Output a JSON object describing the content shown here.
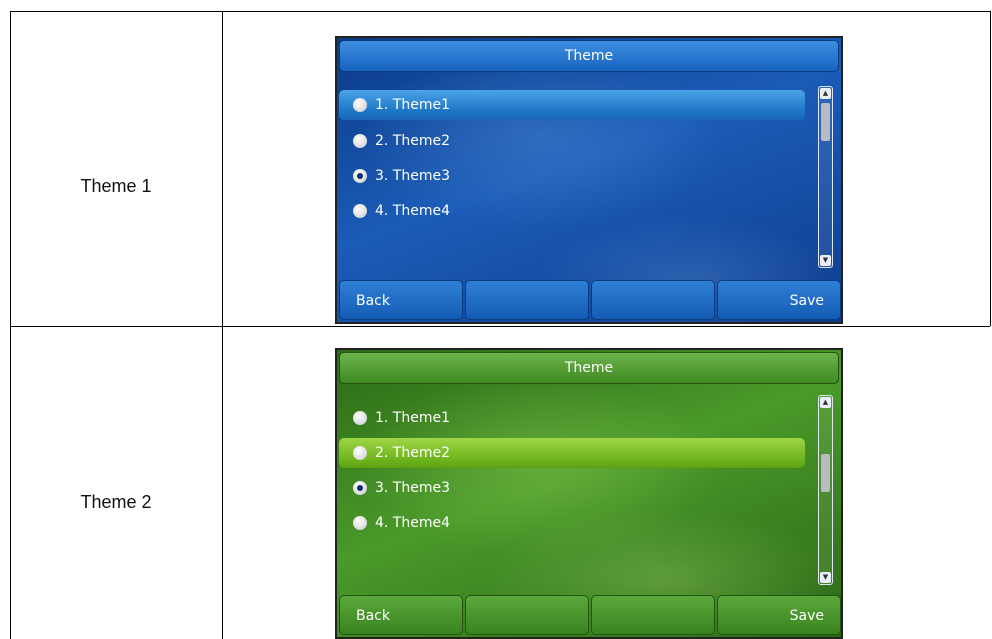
{
  "rows": [
    {
      "label": "Theme 1",
      "screen": {
        "title": "Theme",
        "items": [
          {
            "label": "1. Theme1",
            "checked": false,
            "selected": true
          },
          {
            "label": "2. Theme2",
            "checked": false,
            "selected": false
          },
          {
            "label": "3. Theme3",
            "checked": true,
            "selected": false
          },
          {
            "label": "4. Theme4",
            "checked": false,
            "selected": false
          }
        ],
        "softkeys": [
          "Back",
          "",
          "",
          "Save"
        ],
        "accent": "#1b5cb8"
      }
    },
    {
      "label": "Theme 2",
      "screen": {
        "title": "Theme",
        "items": [
          {
            "label": "1. Theme1",
            "checked": false,
            "selected": false
          },
          {
            "label": "2. Theme2",
            "checked": false,
            "selected": true
          },
          {
            "label": "3. Theme3",
            "checked": true,
            "selected": false
          },
          {
            "label": "4. Theme4",
            "checked": false,
            "selected": false
          }
        ],
        "softkeys": [
          "Back",
          "",
          "",
          "Save"
        ],
        "accent": "#4a9a2a"
      }
    }
  ]
}
